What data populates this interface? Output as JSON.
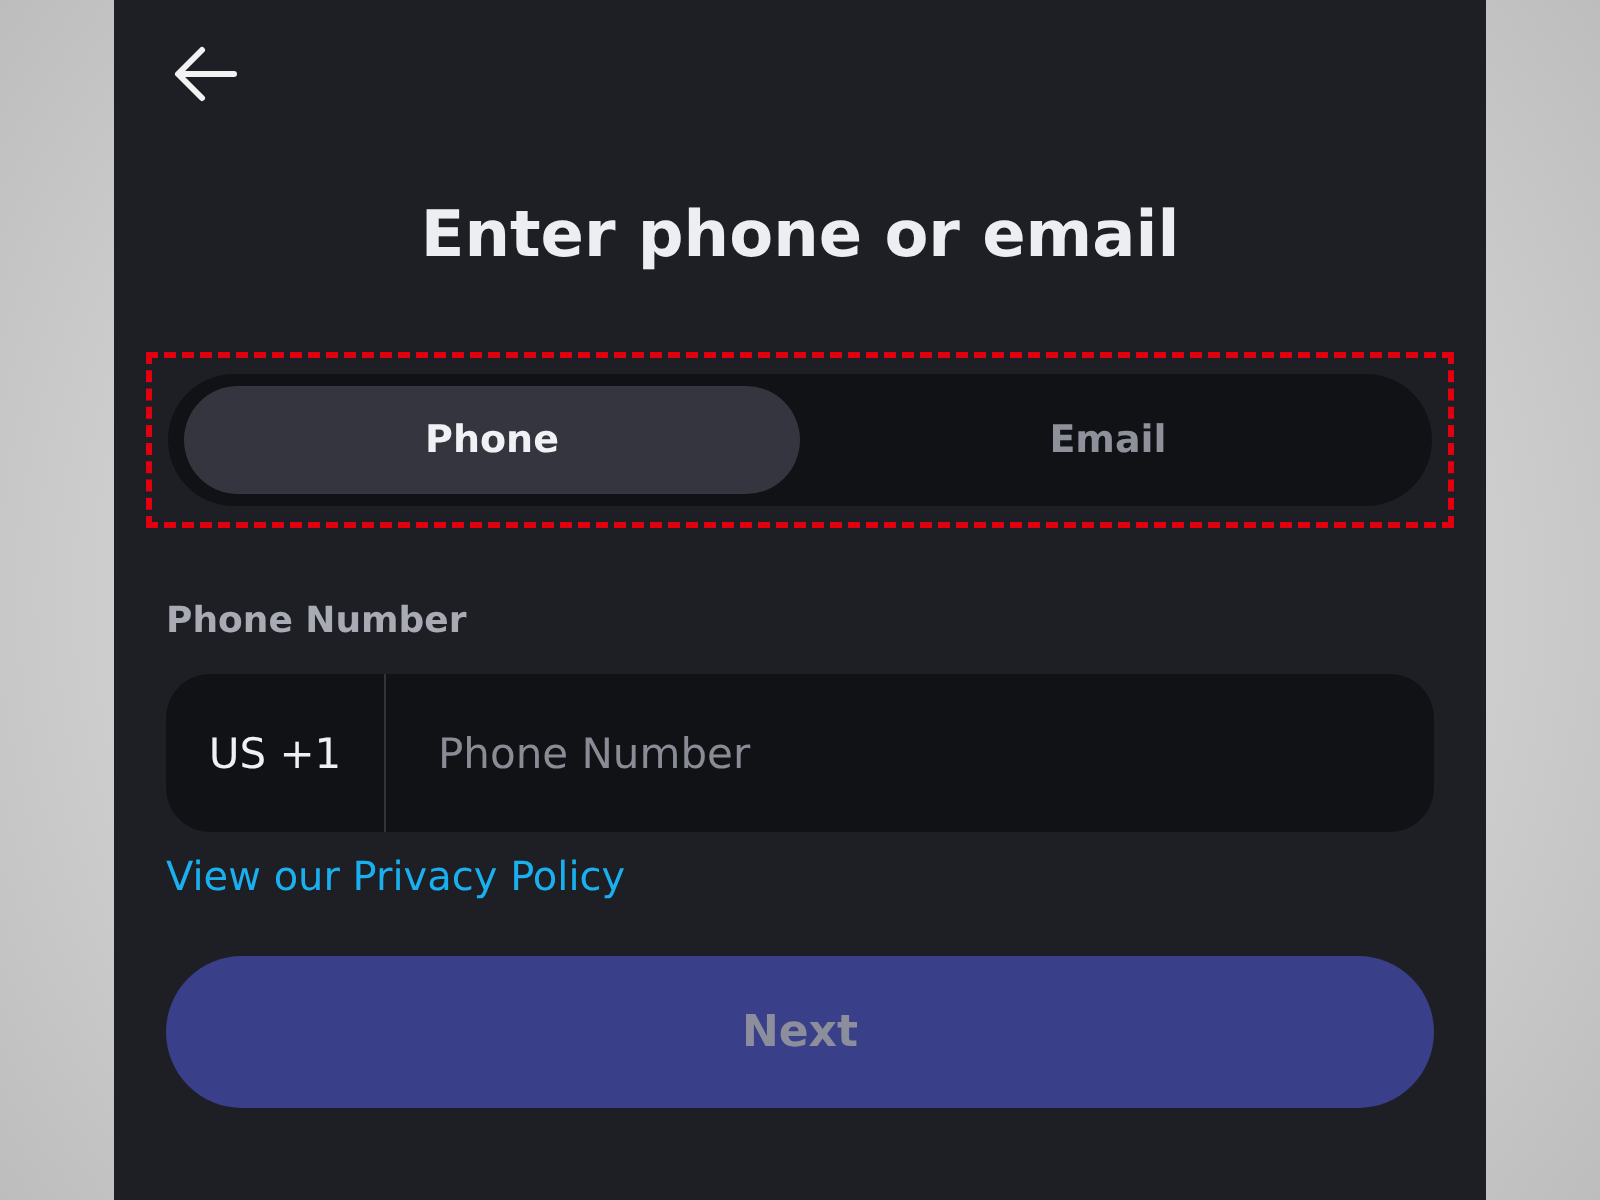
{
  "title": "Enter phone or email",
  "mode_switch": {
    "highlighted": true,
    "tabs": [
      {
        "label": "Phone",
        "selected": true
      },
      {
        "label": "Email",
        "selected": false
      }
    ]
  },
  "field_label": "Phone Number",
  "phone_field": {
    "country_code": "US +1",
    "placeholder": "Phone Number"
  },
  "privacy_link": "View our Privacy Policy",
  "next_button": {
    "label": "Next",
    "disabled": true
  }
}
